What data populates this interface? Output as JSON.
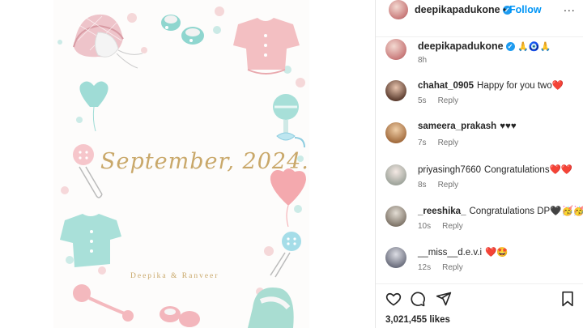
{
  "post": {
    "date_text": "September, 2024.",
    "names_text": "Deepika & Ranveer"
  },
  "header": {
    "username": "deepikapadukone",
    "separator": "•",
    "follow_label": "Follow",
    "more_label": "..."
  },
  "caption": {
    "username": "deepikapadukone",
    "emojis": "🙏🧿🙏",
    "time": "8h"
  },
  "comments": [
    {
      "username": "chahat_0905",
      "text": "Happy for you two❤️",
      "time": "5s",
      "reply": "Reply"
    },
    {
      "username": "sameera_prakash",
      "text": "♥♥♥",
      "time": "7s",
      "reply": "Reply"
    },
    {
      "username": "priyasingh7660",
      "text": "Congratulations❤️❤️",
      "time": "8s",
      "reply": "Reply"
    },
    {
      "username": "_reeshika_",
      "text": "Congratulations DP🖤🥳🥳",
      "time": "10s",
      "reply": "Reply"
    },
    {
      "username": "__miss__d.e.v.i",
      "text": "❤️🤩",
      "time": "12s",
      "reply": "Reply"
    }
  ],
  "footer": {
    "likes": "3,021,455 likes"
  },
  "colors": {
    "follow_blue": "#0095f6",
    "verified_blue": "#1d9bf0",
    "text_dark": "#262626",
    "text_muted": "#737373",
    "script_gold": "#c9a86a"
  }
}
